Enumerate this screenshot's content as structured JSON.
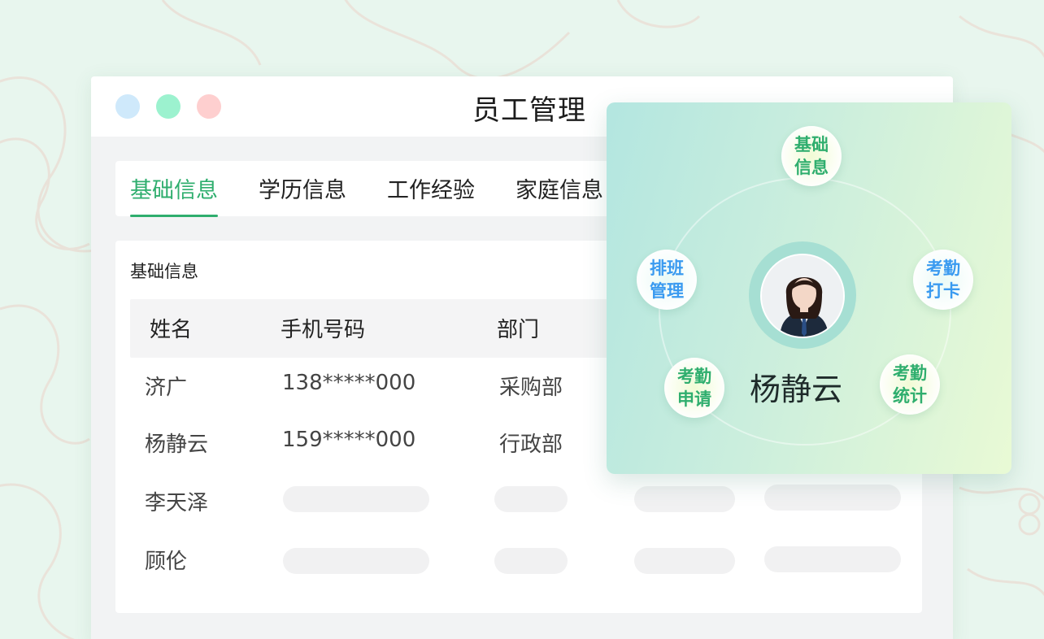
{
  "window": {
    "title": "员工管理",
    "traffic_lights": [
      "#cfe9fb",
      "#9cf2cf",
      "#fecfcf"
    ]
  },
  "tabs": [
    {
      "label": "基础信息",
      "active": true
    },
    {
      "label": "学历信息",
      "active": false
    },
    {
      "label": "工作经验",
      "active": false
    },
    {
      "label": "家庭信息",
      "active": false
    }
  ],
  "section": {
    "title": "基础信息",
    "columns": [
      "姓名",
      "手机号码",
      "部门"
    ],
    "rows": [
      {
        "name": "济广",
        "phone": "138*****000",
        "dept": "采购部"
      },
      {
        "name": "杨静云",
        "phone": "159*****000",
        "dept": "行政部"
      },
      {
        "name": "李天泽",
        "phone": "",
        "dept": ""
      },
      {
        "name": "顾伦",
        "phone": "",
        "dept": ""
      }
    ]
  },
  "profile": {
    "name": "杨静云",
    "actions": {
      "basic_info": "基础信息",
      "schedule": "排班管理",
      "clock_in": "考勤打卡",
      "leave_request": "考勤申请",
      "attendance_stats": "考勤统计"
    }
  },
  "colors": {
    "accent": "#2fae6e",
    "link_blue": "#3a9af0"
  }
}
